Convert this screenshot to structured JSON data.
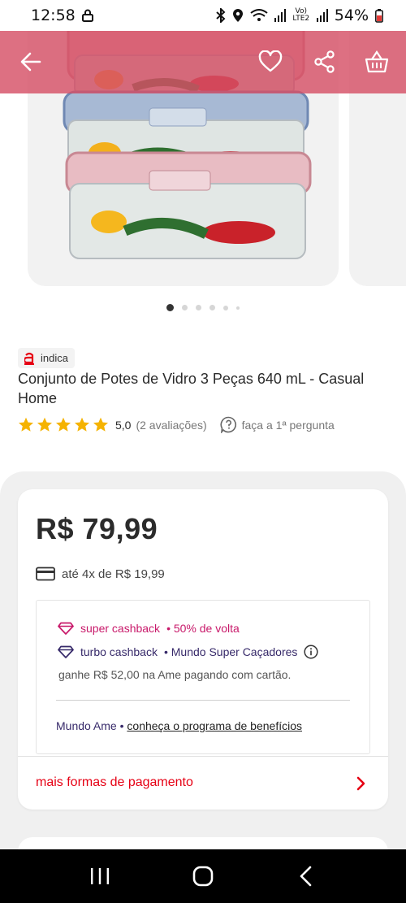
{
  "status_bar": {
    "time": "12:58",
    "battery": "54%",
    "network_label": "Vo) LTE2"
  },
  "toolbar": {
    "back_icon": "arrow-left-icon",
    "favorite_icon": "heart-icon",
    "share_icon": "share-icon",
    "cart_icon": "basket-icon",
    "color": "#d65066"
  },
  "carousel": {
    "total_dots": 6,
    "active_index": 0
  },
  "product": {
    "badge": "indica",
    "title": "Conjunto de Potes de Vidro 3 Peças 640 mL - Casual Home",
    "rating_value": "5,0",
    "rating_count": "(2 avaliações)",
    "stars": 5,
    "question_link": "faça a 1ª pergunta"
  },
  "pricing": {
    "price": "R$ 79,99",
    "installments": "até 4x de R$ 19,99",
    "super_cashback_label": "super cashback",
    "super_cashback_value": "• 50% de volta",
    "turbo_cashback_label": "turbo cashback",
    "turbo_cashback_value": "• Mundo Super Caçadores",
    "ame_note": "ganhe R$ 52,00 na Ame pagando com cartão.",
    "mundo_label": "Mundo Ame •",
    "mundo_link": "conheça o programa de benefícios",
    "more_payment": "mais formas de pagamento"
  },
  "colors": {
    "brand_red": "#e60014",
    "cashback_pink": "#c8196a",
    "turbo_purple": "#372a6a",
    "star_yellow": "#f5b301"
  }
}
